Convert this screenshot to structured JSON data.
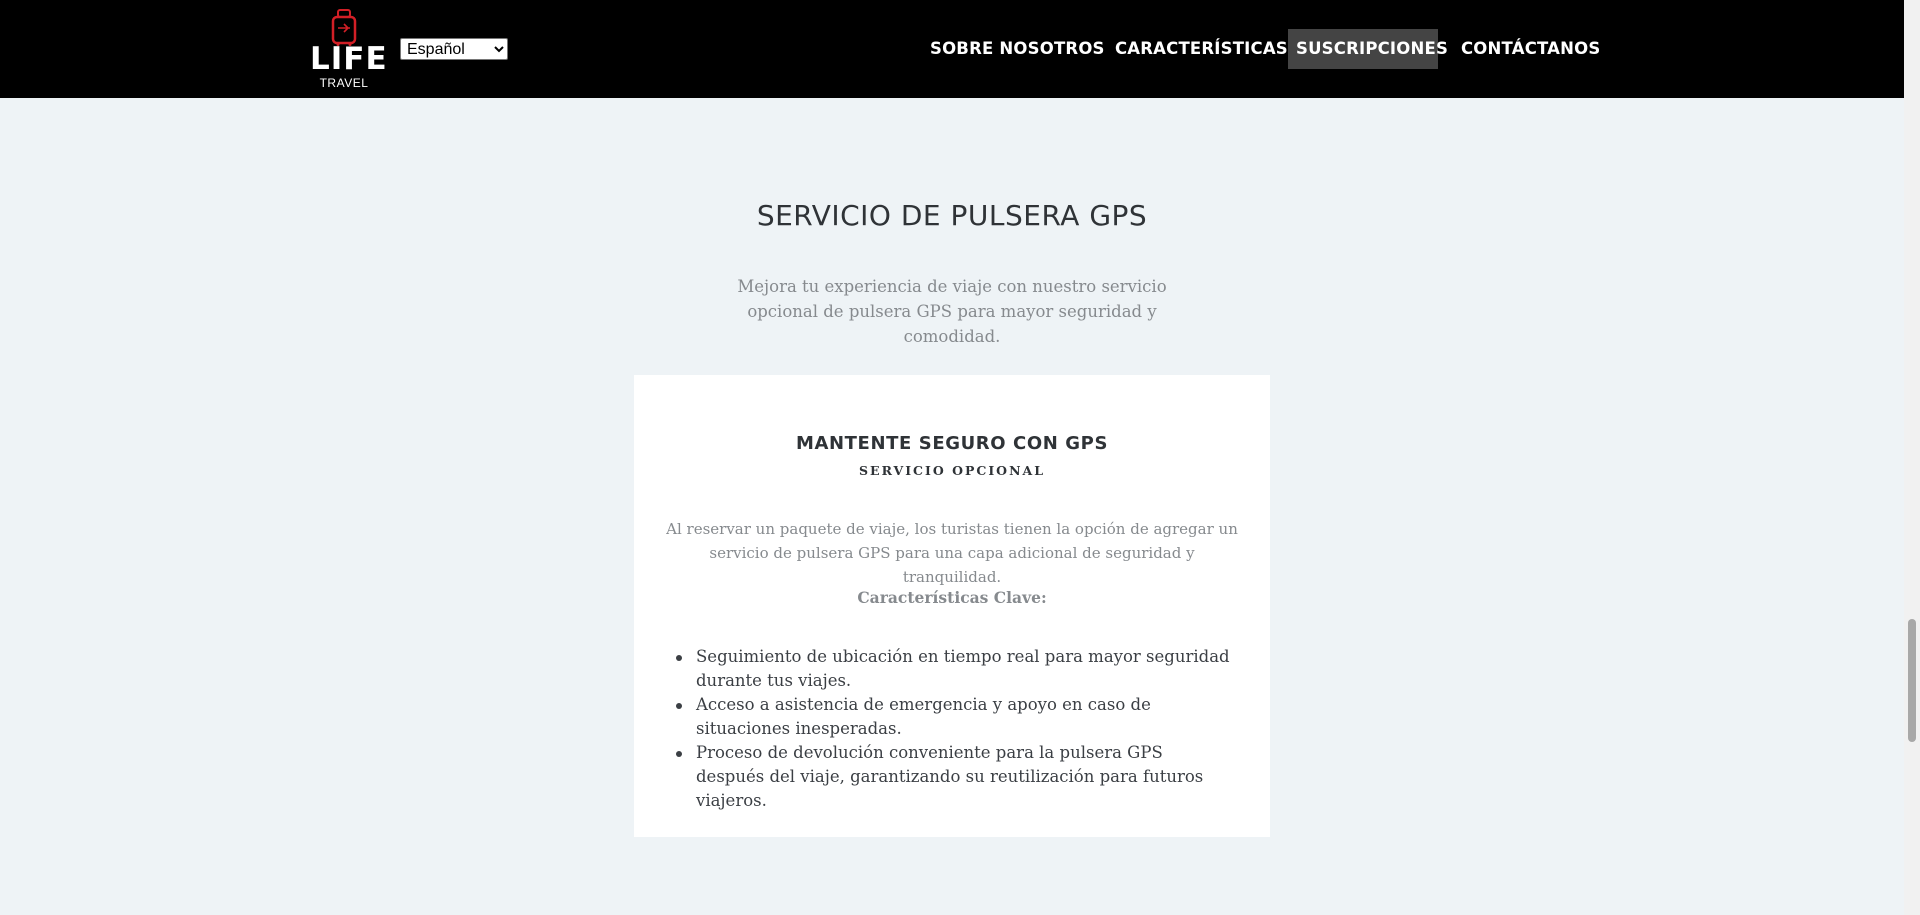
{
  "header": {
    "logo": {
      "word": "LIFE",
      "sub": "TRAVEL",
      "icon": "suitcase-icon",
      "accent_color": "#d21f26"
    },
    "language_select": {
      "selected": "Español"
    },
    "nav": [
      {
        "label": "SOBRE NOSOTROS",
        "active": false
      },
      {
        "label": "CARACTERÍSTICAS",
        "active": false
      },
      {
        "label": "SUSCRIPCIONES",
        "active": true
      },
      {
        "label": "CONTÁCTANOS",
        "active": false
      }
    ]
  },
  "section": {
    "title": "SERVICIO DE PULSERA GPS",
    "intro": "Mejora tu experiencia de viaje con nuestro servicio opcional de pulsera GPS para mayor seguridad y comodidad."
  },
  "card": {
    "title": "MANTENTE SEGURO CON GPS",
    "subtitle": "SERVICIO OPCIONAL",
    "description": "Al reservar un paquete de viaje, los turistas tienen la opción de agregar un servicio de pulsera GPS para una capa adicional de seguridad y tranquilidad.",
    "features_title": "Características Clave:",
    "features": [
      "Seguimiento de ubicación en tiempo real para mayor seguridad durante tus viajes.",
      "Acceso a asistencia de emergencia y apoyo en caso de situaciones inesperadas.",
      "Proceso de devolución conveniente para la pulsera GPS después del viaje, garantizando su reutilización para futuros viajeros."
    ]
  },
  "colors": {
    "header_bg": "#000000",
    "page_bg": "#eef3f6",
    "active_nav_bg": "#444444"
  }
}
